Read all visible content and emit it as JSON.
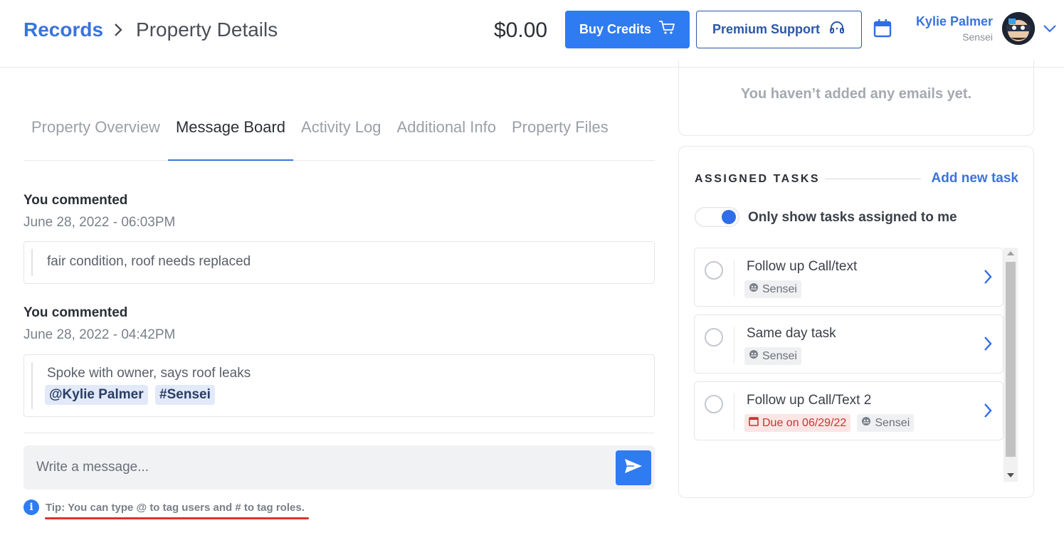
{
  "header": {
    "breadcrumb_root": "Records",
    "breadcrumb_current": "Property Details",
    "balance": "$0.00",
    "buy_credits_label": "Buy Credits",
    "premium_support_label": "Premium Support",
    "user_name": "Kylie Palmer",
    "user_role": "Sensei"
  },
  "tabs": [
    {
      "label": "Property Overview",
      "active": false
    },
    {
      "label": "Message Board",
      "active": true
    },
    {
      "label": "Activity Log",
      "active": false
    },
    {
      "label": "Additional Info",
      "active": false
    },
    {
      "label": "Property Files",
      "active": false
    }
  ],
  "comments": [
    {
      "author_line": "You commented",
      "date": "June 28, 2022 - 06:03PM",
      "text": "fair condition, roof needs replaced",
      "tags": []
    },
    {
      "author_line": "You commented",
      "date": "June 28, 2022 - 04:42PM",
      "text": "Spoke with owner, says roof leaks",
      "tags": [
        "@Kylie Palmer",
        "#Sensei"
      ]
    }
  ],
  "message_input": {
    "placeholder": "Write a message..."
  },
  "tip": "Tip: You can type @ to tag users and # to tag roles.",
  "emails": {
    "empty_text": "You haven’t added any emails yet."
  },
  "tasks": {
    "title": "ASSIGNED TASKS",
    "add_label": "Add new task",
    "toggle_label": "Only show tasks assigned to me",
    "toggle_on": true,
    "items": [
      {
        "title": "Follow up Call/text",
        "due": "",
        "role": "Sensei"
      },
      {
        "title": "Same day task",
        "due": "",
        "role": "Sensei"
      },
      {
        "title": "Follow up Call/Text 2",
        "due": "Due on 06/29/22",
        "role": "Sensei"
      }
    ]
  },
  "colors": {
    "primary": "#2f7bf1",
    "link": "#3a73dc",
    "due": "#c7342f",
    "tip_underline": "#e0322b"
  }
}
